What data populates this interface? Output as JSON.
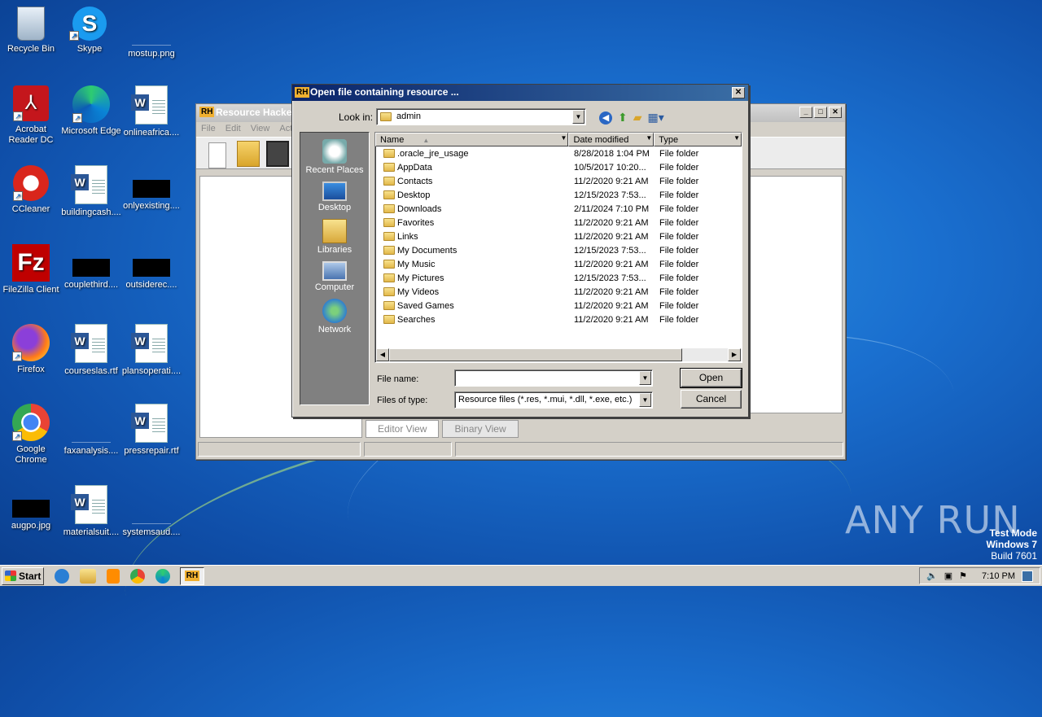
{
  "desktop": {
    "icons": [
      {
        "label": "Recycle Bin"
      },
      {
        "label": "Skype"
      },
      {
        "label": "mostup.png"
      },
      {
        "label": "Acrobat Reader DC"
      },
      {
        "label": "Microsoft Edge"
      },
      {
        "label": "onlineafrica...."
      },
      {
        "label": "CCleaner"
      },
      {
        "label": "buildingcash...."
      },
      {
        "label": "onlyexisting...."
      },
      {
        "label": "FileZilla Client"
      },
      {
        "label": "couplethird...."
      },
      {
        "label": "outsiderec...."
      },
      {
        "label": "Firefox"
      },
      {
        "label": "courseslas.rtf"
      },
      {
        "label": "plansoperati...."
      },
      {
        "label": "Google Chrome"
      },
      {
        "label": "faxanalysis...."
      },
      {
        "label": "pressrepair.rtf"
      },
      {
        "label": "augpo.jpg"
      },
      {
        "label": "materialsuit...."
      },
      {
        "label": "systemsaud...."
      }
    ]
  },
  "resource_hacker": {
    "title": "Resource Hacker",
    "logo": "RH",
    "menu": [
      "File",
      "Edit",
      "View",
      "Act"
    ],
    "tabs": [
      "Editor View",
      "Binary View"
    ]
  },
  "dialog": {
    "title": "Open file containing resource ...",
    "logo": "RH",
    "look_in_label": "Look in:",
    "look_in_value": "admin",
    "places": [
      "Recent Places",
      "Desktop",
      "Libraries",
      "Computer",
      "Network"
    ],
    "columns": [
      "Name",
      "Date modified",
      "Type"
    ],
    "rows": [
      {
        "name": ".oracle_jre_usage",
        "date": "8/28/2018 1:04 PM",
        "type": "File folder"
      },
      {
        "name": "AppData",
        "date": "10/5/2017 10:20...",
        "type": "File folder"
      },
      {
        "name": "Contacts",
        "date": "11/2/2020 9:21 AM",
        "type": "File folder"
      },
      {
        "name": "Desktop",
        "date": "12/15/2023 7:53...",
        "type": "File folder"
      },
      {
        "name": "Downloads",
        "date": "2/11/2024 7:10 PM",
        "type": "File folder"
      },
      {
        "name": "Favorites",
        "date": "11/2/2020 9:21 AM",
        "type": "File folder"
      },
      {
        "name": "Links",
        "date": "11/2/2020 9:21 AM",
        "type": "File folder"
      },
      {
        "name": "My Documents",
        "date": "12/15/2023 7:53...",
        "type": "File folder"
      },
      {
        "name": "My Music",
        "date": "11/2/2020 9:21 AM",
        "type": "File folder"
      },
      {
        "name": "My Pictures",
        "date": "12/15/2023 7:53...",
        "type": "File folder"
      },
      {
        "name": "My Videos",
        "date": "11/2/2020 9:21 AM",
        "type": "File folder"
      },
      {
        "name": "Saved Games",
        "date": "11/2/2020 9:21 AM",
        "type": "File folder"
      },
      {
        "name": "Searches",
        "date": "11/2/2020 9:21 AM",
        "type": "File folder"
      }
    ],
    "file_name_label": "File name:",
    "file_name_value": "",
    "files_of_type_label": "Files of type:",
    "files_of_type_value": "Resource files (*.res, *.mui, *.dll, *.exe, etc.)",
    "open_label": "Open",
    "cancel_label": "Cancel"
  },
  "taskbar": {
    "start_label": "Start",
    "clock": "7:10 PM"
  },
  "overlay": {
    "watermark": "ANY RUN",
    "test_mode_line1": "Test Mode",
    "test_mode_line2": "Windows 7",
    "test_mode_line3": "Build 7601"
  }
}
